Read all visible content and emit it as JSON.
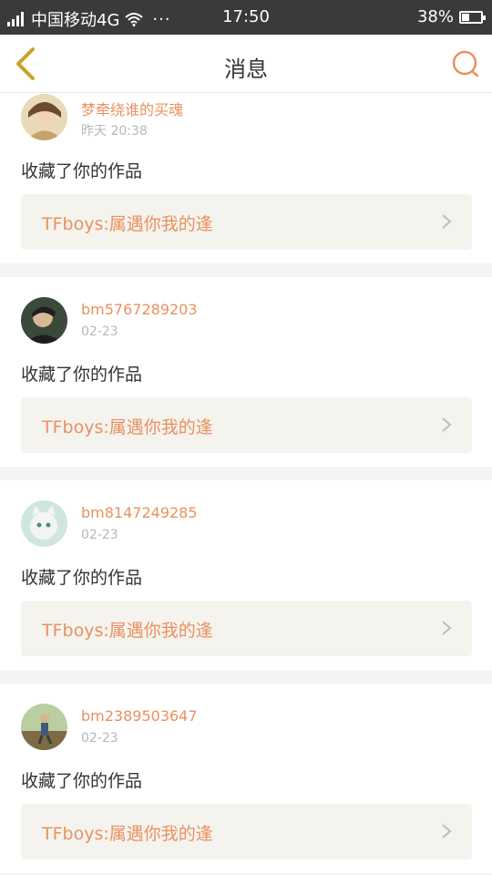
{
  "status_bar": {
    "carrier": "中国移动4G",
    "dots": "···",
    "time": "17:50",
    "battery_text": "38%",
    "battery_level": 0.38
  },
  "nav": {
    "title": "消息",
    "back_icon": "chevron-left-icon",
    "search_icon": "search-icon",
    "accent_color": "#e9915f"
  },
  "messages": [
    {
      "user": "梦牵绕谁的买魂",
      "time": "昨天 20:38",
      "action": "收藏了你的作品",
      "work_title": "TFboys:属遇你我的逢"
    },
    {
      "user": "bm5767289203",
      "time": "02-23",
      "action": "收藏了你的作品",
      "work_title": "TFboys:属遇你我的逢"
    },
    {
      "user": "bm8147249285",
      "time": "02-23",
      "action": "收藏了你的作品",
      "work_title": "TFboys:属遇你我的逢"
    },
    {
      "user": "bm2389503647",
      "time": "02-23",
      "action": "收藏了你的作品",
      "work_title": "TFboys:属遇你我的逢"
    }
  ]
}
